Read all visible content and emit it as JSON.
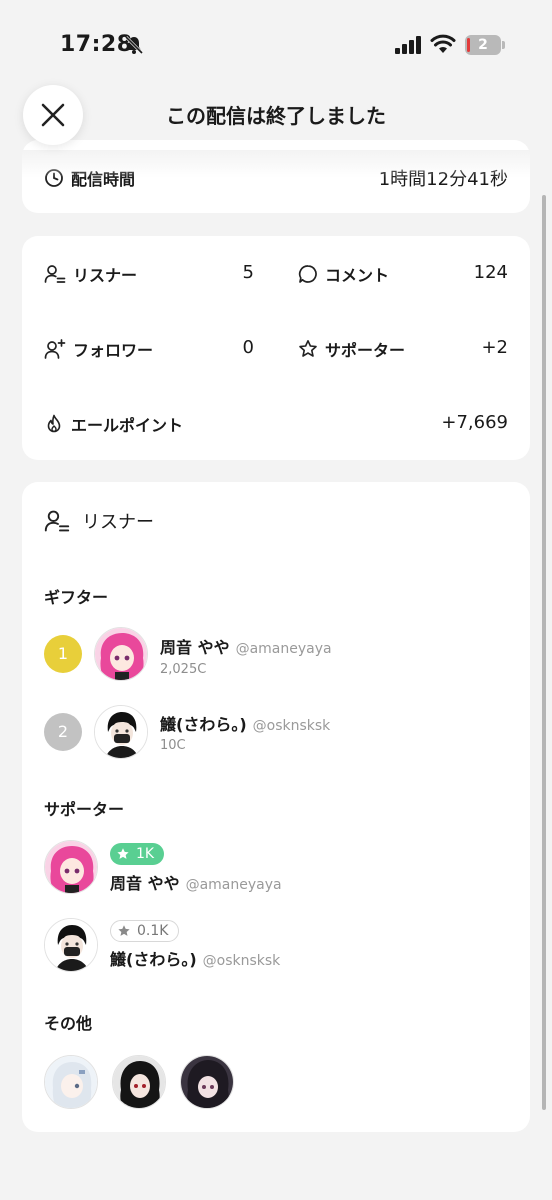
{
  "status_bar": {
    "time": "17:28",
    "battery": "2"
  },
  "header": {
    "title": "この配信は終了しました"
  },
  "duration": {
    "label": "配信時間",
    "value": "1時間12分41秒"
  },
  "stats": {
    "listeners": {
      "label": "リスナー",
      "value": "5"
    },
    "comments": {
      "label": "コメント",
      "value": "124"
    },
    "followers": {
      "label": "フォロワー",
      "value": "0"
    },
    "supporters": {
      "label": "サポーター",
      "value": "+2"
    },
    "yell_points": {
      "label": "エールポイント",
      "value": "+7,669"
    }
  },
  "listeners_card": {
    "title": "リスナー",
    "gifters_title": "ギフター",
    "gifters": [
      {
        "rank": "1",
        "name": "周音 やや",
        "handle": "@amaneyaya",
        "amount": "2,025C"
      },
      {
        "rank": "2",
        "name": "鱶(さわら。)",
        "handle": "@osknsksk",
        "amount": "10C"
      }
    ],
    "supporters_title": "サポーター",
    "supporters": [
      {
        "badge": "1K",
        "name": "周音 やや",
        "handle": "@amaneyaya"
      },
      {
        "badge": "0.1K",
        "name": "鱶(さわら。)",
        "handle": "@osknsksk"
      }
    ],
    "others_title": "その他"
  },
  "colors": {
    "rank1": "#e8cf3a",
    "rank2": "#c2c2c2",
    "badge_green": "#59cf92"
  }
}
